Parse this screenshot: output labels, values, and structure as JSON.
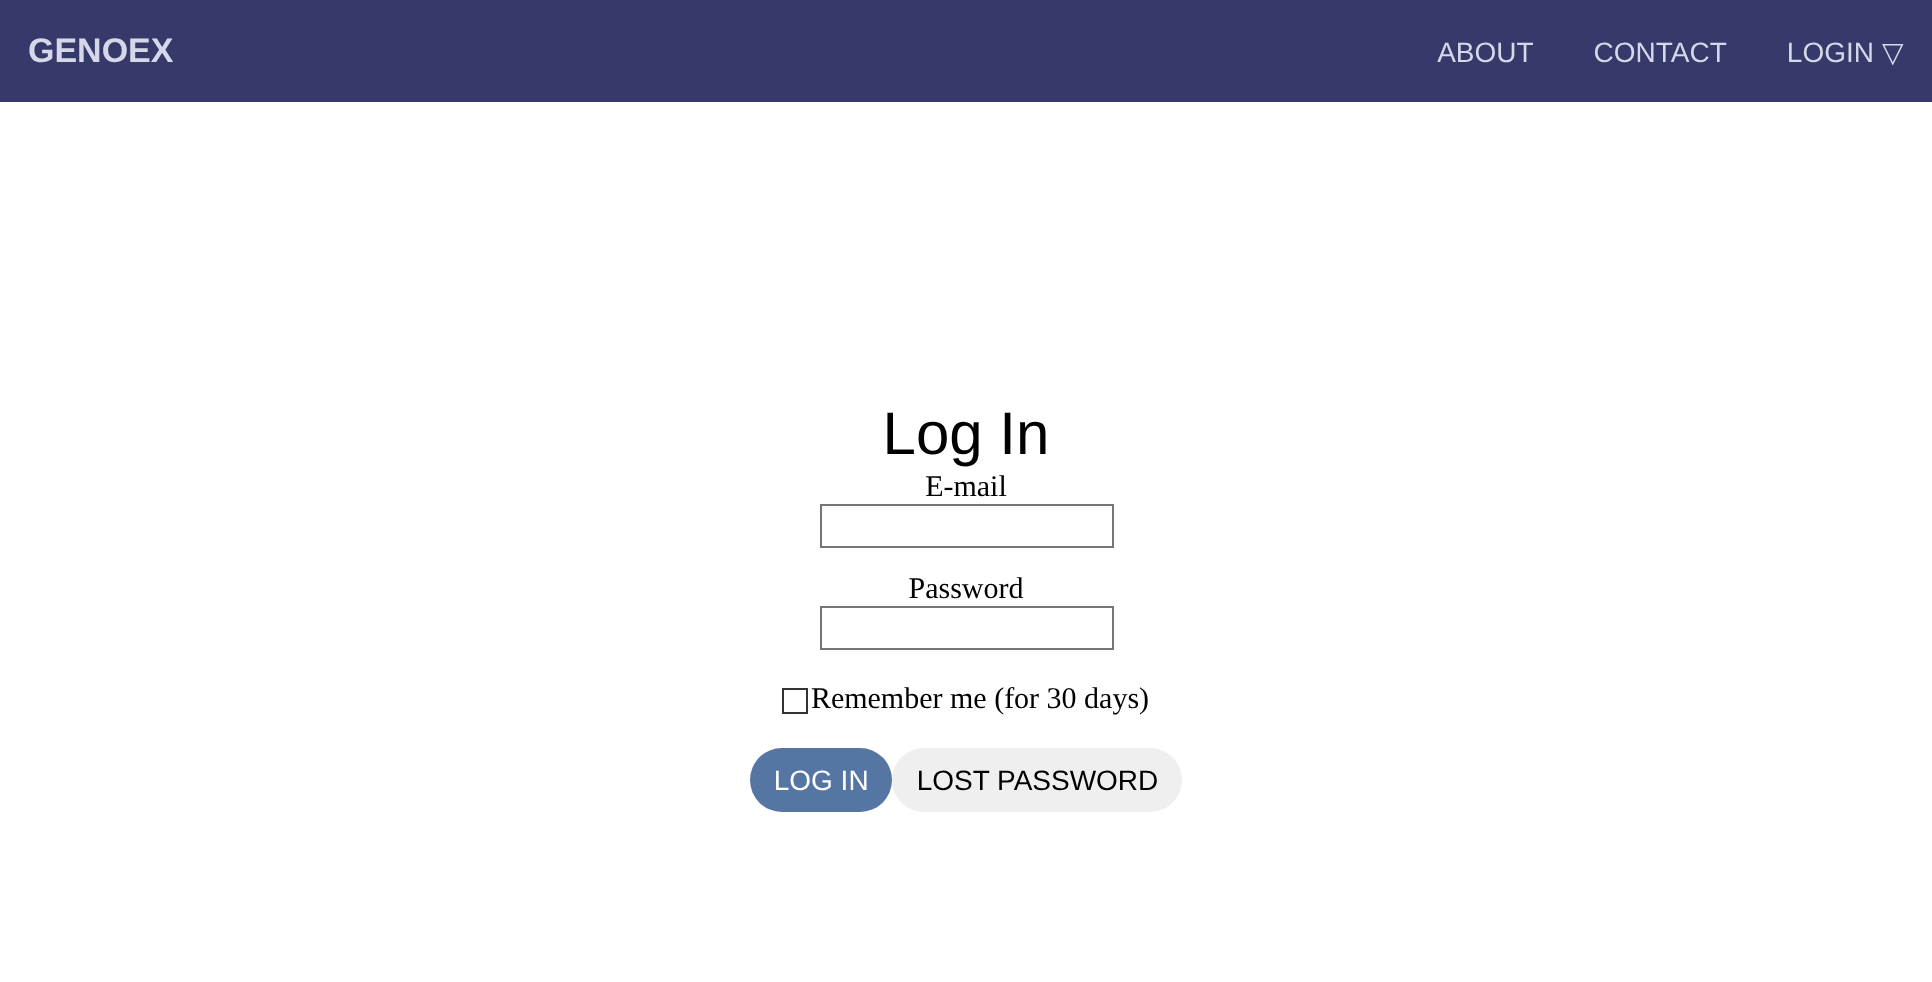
{
  "navbar": {
    "brand": "GENOEX",
    "links": [
      {
        "label": "ABOUT"
      },
      {
        "label": "CONTACT"
      },
      {
        "label": "LOGIN",
        "caret": "▽"
      }
    ]
  },
  "form": {
    "title": "Log In",
    "fields": [
      {
        "label": "E-mail"
      },
      {
        "label": "Password"
      }
    ],
    "remember": {
      "label": "Remember me (for 30 days)",
      "checked": false
    },
    "buttons": [
      {
        "label": "LOG IN",
        "kind": "primary"
      },
      {
        "label": "LOST PASSWORD",
        "kind": "secondary"
      }
    ]
  }
}
